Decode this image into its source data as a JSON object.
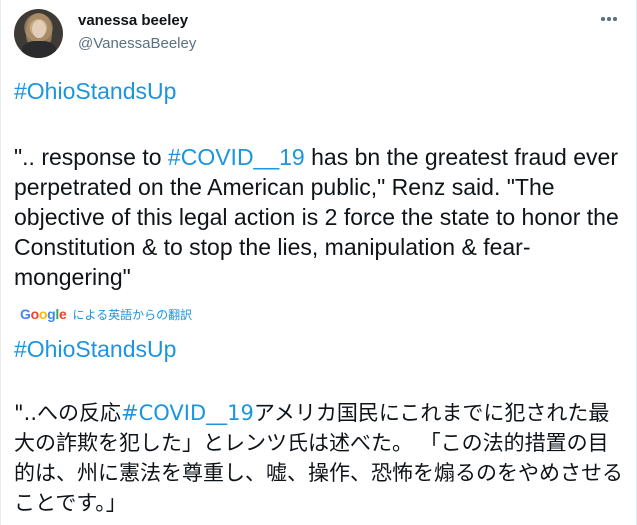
{
  "author": {
    "display_name": "vanessa beeley",
    "handle": "@VanessaBeeley",
    "avatar_icon": "profile-photo-avatar"
  },
  "menu": {
    "icon": "more-options-icon"
  },
  "tweet": {
    "hashtag_1": "#OhioStandsUp",
    "quote_open": "\".. response to ",
    "hashtag_covid": "#COVID__19",
    "quote_rest": " has bn the greatest fraud ever perpetrated on the American public,\" Renz said. \"The objective of this legal action is 2 force the state to honor the Constitution & to stop the lies, manipulation & fear-mongering\""
  },
  "translation_bar": {
    "google_logo": "Google",
    "label": "による英語からの翻訳"
  },
  "translated": {
    "hashtag_1": "#OhioStandsUp",
    "quote_open": "\"..への反応",
    "hashtag_covid": "#COVID__19",
    "quote_rest": "アメリカ国民にこれまでに犯された最大の詐欺を犯した」とレンツ氏は述べた。 「この法的措置の目的は、州に憲法を尊重し、嘘、操作、恐怖を煽るのをやめさせることです。」"
  },
  "colors": {
    "link": "#1b95e0",
    "text": "#0f1419",
    "secondary": "#5b7083"
  }
}
